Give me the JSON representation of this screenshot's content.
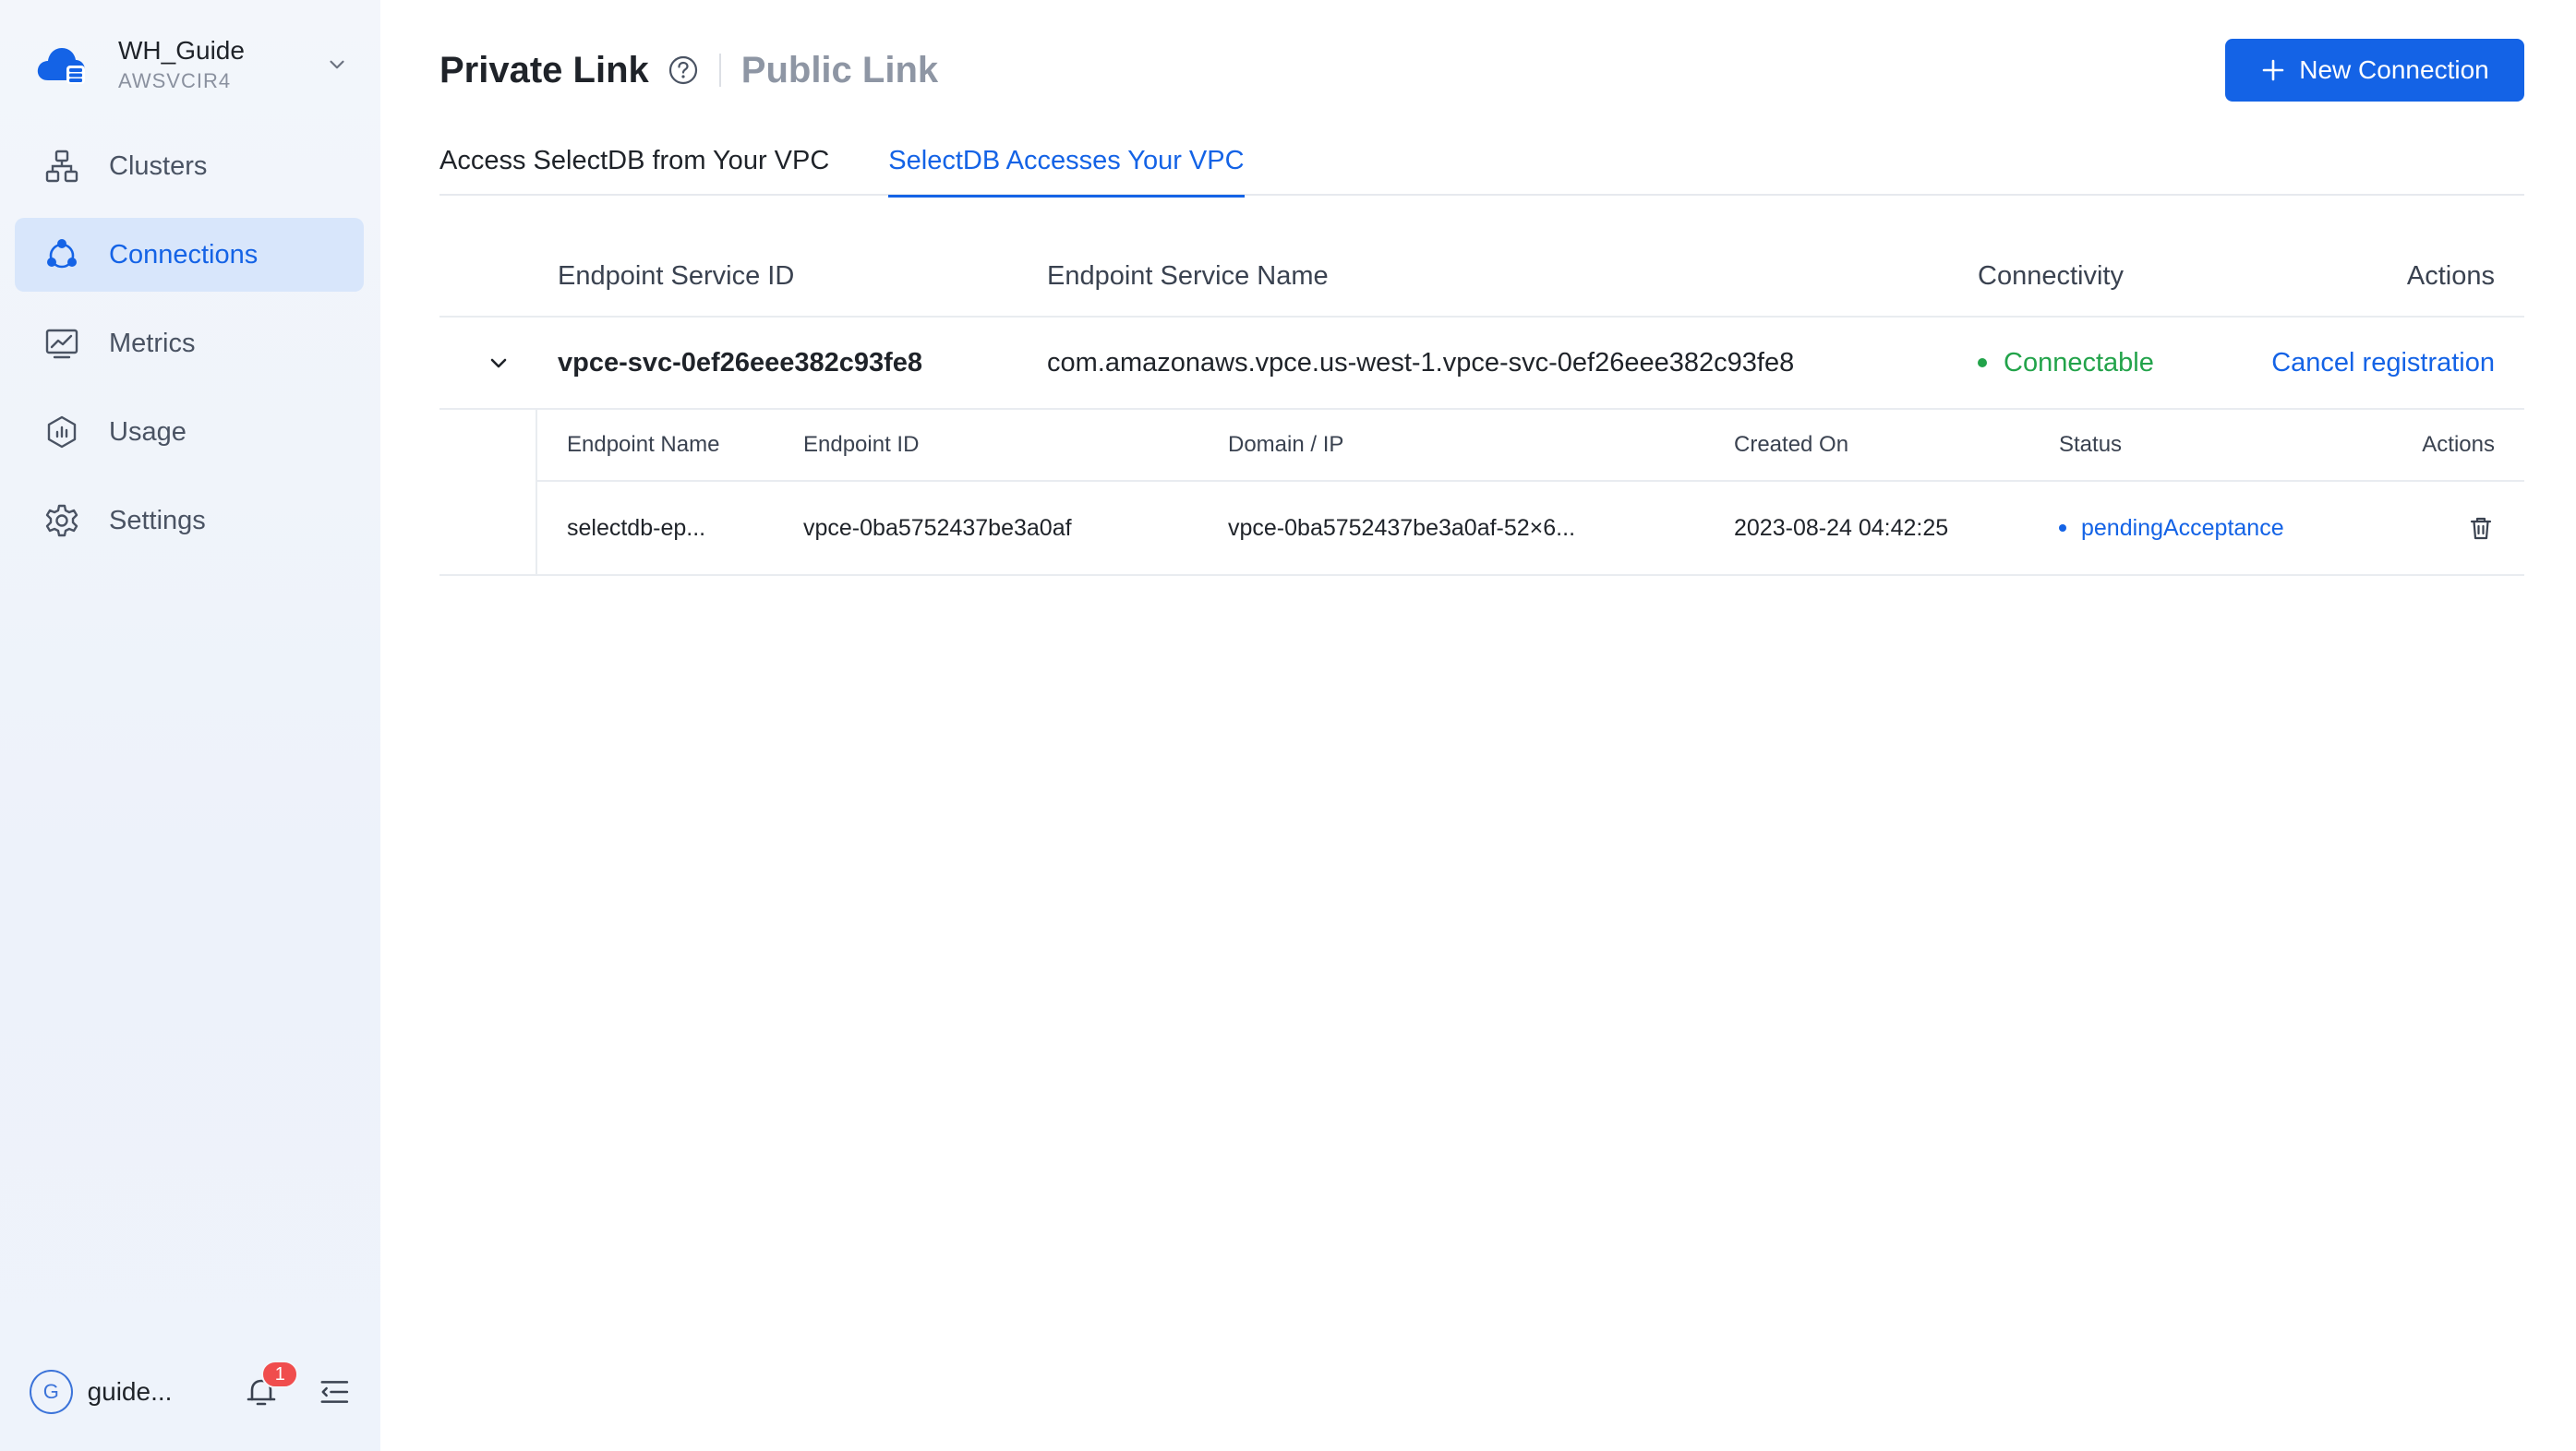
{
  "workspace": {
    "name": "WH_Guide",
    "id": "AWSVCIR4"
  },
  "sidebar": {
    "items": [
      {
        "label": "Clusters",
        "icon": "clusters-icon"
      },
      {
        "label": "Connections",
        "icon": "connections-icon",
        "active": true
      },
      {
        "label": "Metrics",
        "icon": "metrics-icon"
      },
      {
        "label": "Usage",
        "icon": "usage-icon"
      },
      {
        "label": "Settings",
        "icon": "settings-icon"
      }
    ],
    "user": {
      "initial": "G",
      "name": "guide..."
    },
    "notifications": {
      "count": "1"
    }
  },
  "header": {
    "title": "Private Link",
    "alt_title": "Public Link",
    "new_button": "New Connection"
  },
  "tabs": [
    {
      "label": "Access SelectDB from Your VPC",
      "active": false
    },
    {
      "label": "SelectDB Accesses Your VPC",
      "active": true
    }
  ],
  "table": {
    "columns": {
      "service_id": "Endpoint Service ID",
      "service_name": "Endpoint Service Name",
      "connectivity": "Connectivity",
      "actions": "Actions"
    },
    "rows": [
      {
        "service_id": "vpce-svc-0ef26eee382c93fe8",
        "service_name": "com.amazonaws.vpce.us-west-1.vpce-svc-0ef26eee382c93fe8",
        "connectivity": "Connectable",
        "action": "Cancel registration",
        "endpoints": {
          "columns": {
            "name": "Endpoint Name",
            "id": "Endpoint ID",
            "domain": "Domain / IP",
            "created": "Created On",
            "status": "Status",
            "actions": "Actions"
          },
          "rows": [
            {
              "name": "selectdb-ep...",
              "id": "vpce-0ba5752437be3a0af",
              "domain": "vpce-0ba5752437be3a0af-52×6...",
              "created": "2023-08-24 04:42:25",
              "status": "pendingAcceptance"
            }
          ]
        }
      }
    ]
  },
  "colors": {
    "accent": "#1463e6",
    "success": "#22a34a",
    "sidebar_bg": "#f3f6fb",
    "active_nav_bg": "#d8e6fb",
    "badge": "#f04d4d"
  }
}
